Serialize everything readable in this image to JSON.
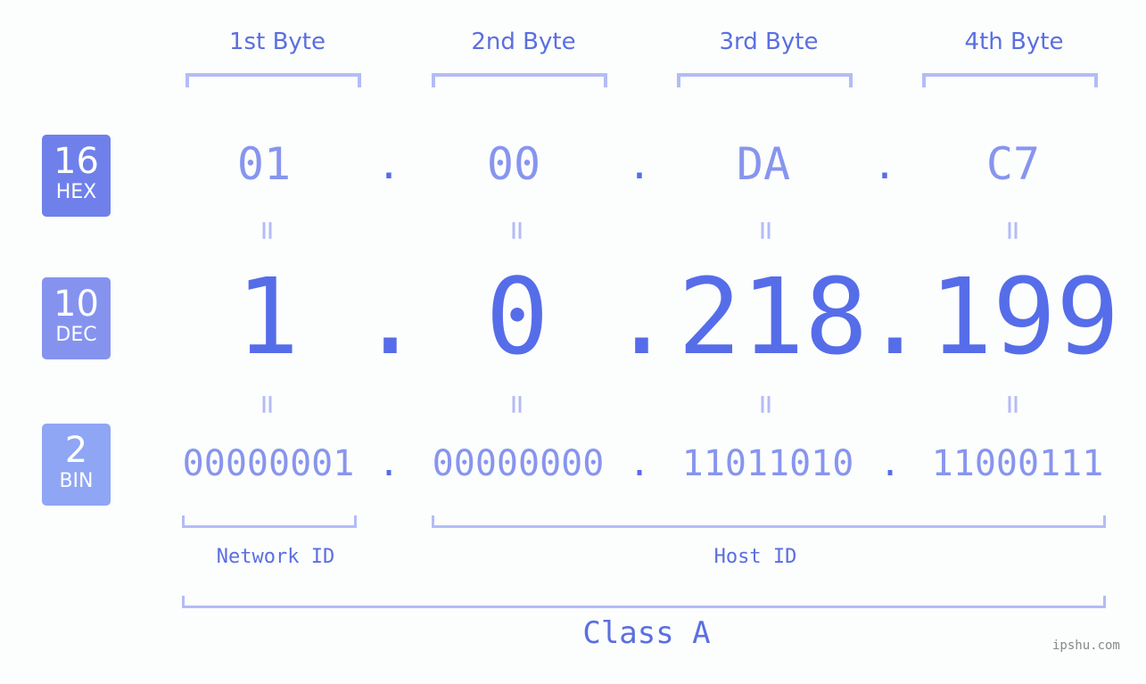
{
  "headers": [
    "1st Byte",
    "2nd Byte",
    "3rd Byte",
    "4th Byte"
  ],
  "badges": {
    "hex": {
      "num": "16",
      "label": "HEX",
      "color": "#6f80ea"
    },
    "dec": {
      "num": "10",
      "label": "DEC",
      "color": "#8593ef"
    },
    "bin": {
      "num": "2",
      "label": "BIN",
      "color": "#8fa6f5"
    }
  },
  "hex": [
    "01",
    "00",
    "DA",
    "C7"
  ],
  "dec": [
    "1",
    "0",
    "218",
    "199"
  ],
  "bin": [
    "00000001",
    "00000000",
    "11011010",
    "11000111"
  ],
  "separator": ".",
  "equals": "=",
  "network_id_label": "Network ID",
  "host_id_label": "Host ID",
  "class_label": "Class A",
  "watermark": "ipshu.com",
  "colors": {
    "primary": "#566de9",
    "light": "#8795ee",
    "bracket": "#b3bcf6"
  }
}
